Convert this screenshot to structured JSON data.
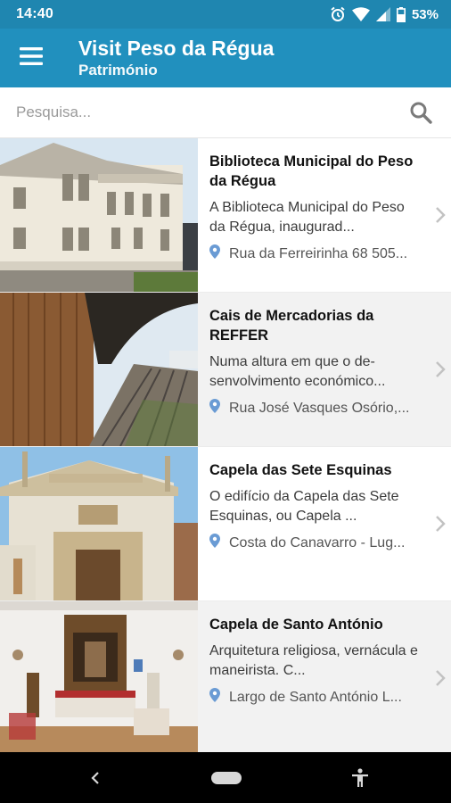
{
  "status": {
    "time": "14:40",
    "battery": "53%"
  },
  "app": {
    "title": "Visit Peso da Régua",
    "subtitle": "Património"
  },
  "search": {
    "placeholder": "Pesquisa..."
  },
  "items": [
    {
      "title": "Biblioteca Municipal do Peso da Régua",
      "description": "A Biblioteca Municipal do Peso da Régua, inaugurad...",
      "address": "Rua da Ferreirinha 68 505..."
    },
    {
      "title": "Cais de Mercadorias da REFFER",
      "description": "Numa altura em que o de-senvolvimento económico...",
      "address": "Rua José Vasques Osório,..."
    },
    {
      "title": "Capela das Sete Esquinas",
      "description": "O edifício da Capela das Sete Esquinas, ou Capela ...",
      "address": "Costa do Canavarro - Lug..."
    },
    {
      "title": "Capela de Santo António",
      "description": "Arquitetura religiosa, vernácula e maneirista. C...",
      "address": "Largo de Santo António L..."
    }
  ],
  "icons": {
    "menu": "hamburger-menu-icon",
    "search": "search-icon",
    "pin": "location-pin-icon",
    "chevron": "chevron-right-icon",
    "back": "back-icon",
    "home": "home-pill-icon",
    "accessibility": "accessibility-icon"
  },
  "colors": {
    "app_bar": "#2190be",
    "status_bar": "#1f86b0",
    "pin": "#6a9bd4",
    "alt_row": "#f2f2f2"
  }
}
